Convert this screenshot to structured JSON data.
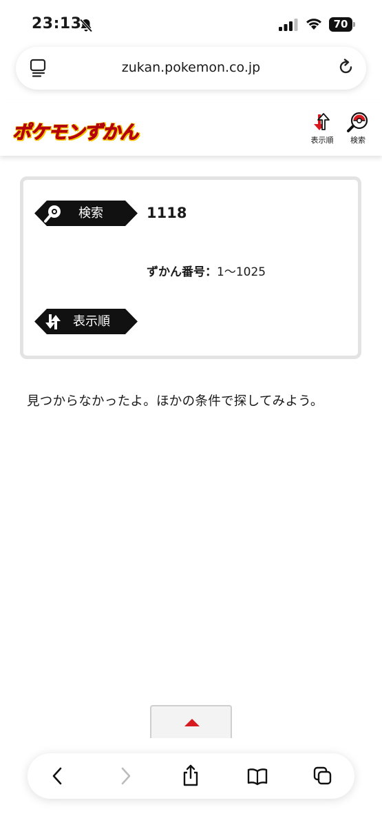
{
  "status_bar": {
    "time": "23:13",
    "battery": "70"
  },
  "browser": {
    "url": "zukan.pokemon.co.jp"
  },
  "site_header": {
    "logo_text": "ポケモンずかん",
    "sort_label": "表示順",
    "search_label": "検索"
  },
  "conditions": {
    "search_tag": "検索",
    "search_value": "1118",
    "range_label": "ずかん番号：",
    "range_value": "1〜1025",
    "sort_tag": "表示順"
  },
  "message": "見つからなかったよ。ほかの条件で探してみよう。",
  "colors": {
    "brand_red": "#e60012",
    "logo_outline": "#f5c400",
    "tag_bg": "#111111",
    "page_top_arrow": "#d71920"
  },
  "icons": {
    "status": [
      "bell-slash-icon",
      "signal-icon",
      "wifi-icon",
      "battery-icon"
    ],
    "url_bar": [
      "tab-overview-icon",
      "reload-icon"
    ],
    "header": [
      "sort-icon",
      "search-icon"
    ],
    "toolbar": [
      "back-icon",
      "forward-icon",
      "share-icon",
      "bookmarks-icon",
      "tabs-icon"
    ]
  }
}
